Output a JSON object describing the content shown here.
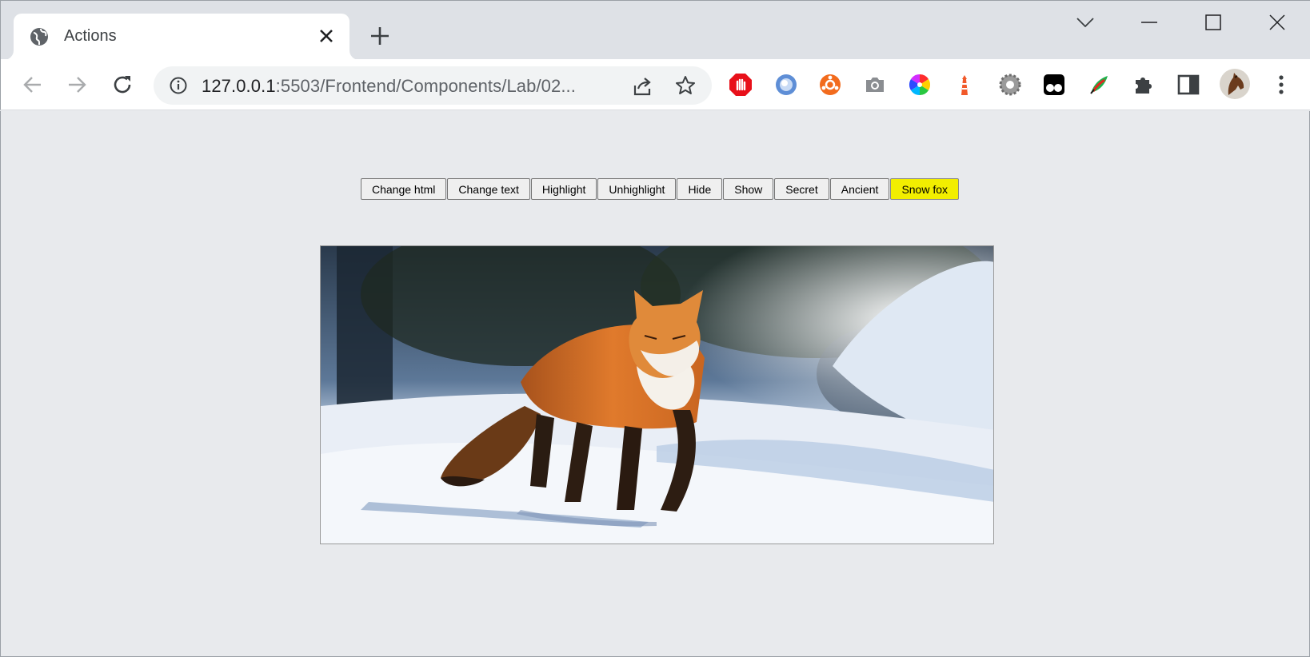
{
  "tab": {
    "title": "Actions",
    "favicon": "globe-icon"
  },
  "window_controls": [
    "chevron-down-icon",
    "minimize-icon",
    "maximize-icon",
    "close-icon"
  ],
  "address": {
    "host": "127.0.0.1",
    "path": ":5503/Frontend/Components/Lab/02..."
  },
  "extensions": [
    "adblock-icon",
    "blue-orb-icon",
    "orange-circle-icon",
    "camera-icon",
    "color-wheel-icon",
    "lighthouse-icon",
    "gear-icon",
    "tampermonkey-icon",
    "feather-icon",
    "puzzle-icon",
    "sidebar-icon",
    "avatar",
    "kebab-menu-icon"
  ],
  "page": {
    "buttons": [
      "Change html",
      "Change text",
      "Highlight",
      "Unhighlight",
      "Hide",
      "Show",
      "Secret",
      "Ancient",
      "Snow fox"
    ],
    "image_subject": "red fox walking in snow"
  },
  "colors": {
    "highlight": "#f2ee00",
    "tab_bg": "#ffffff",
    "frame": "#dee1e6"
  }
}
